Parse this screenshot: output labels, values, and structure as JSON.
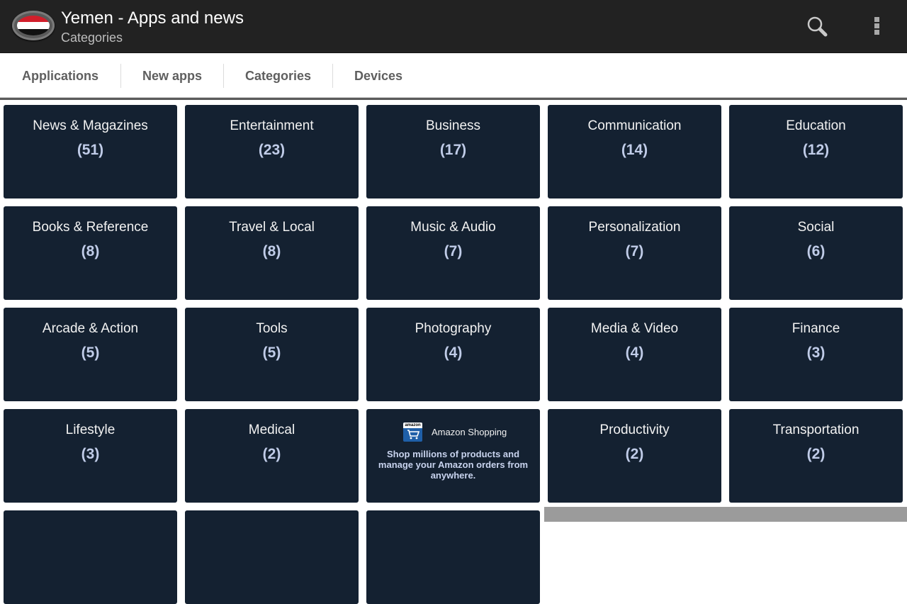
{
  "appbar": {
    "title": "Yemen - Apps and news",
    "subtitle": "Categories",
    "logo_icon": "yemen-flag-icon",
    "actions": [
      {
        "name": "search",
        "icon": "search-icon"
      },
      {
        "name": "overflow-menu",
        "icon": "more-vert-icon"
      }
    ]
  },
  "tabs": [
    {
      "label": "Applications"
    },
    {
      "label": "New apps"
    },
    {
      "label": "Categories"
    },
    {
      "label": "Devices"
    }
  ],
  "categories": [
    {
      "name": "News & Magazines",
      "count": "(51)"
    },
    {
      "name": "Entertainment",
      "count": "(23)"
    },
    {
      "name": "Business",
      "count": "(17)"
    },
    {
      "name": "Communication",
      "count": "(14)"
    },
    {
      "name": "Education",
      "count": "(12)"
    },
    {
      "name": "Books & Reference",
      "count": "(8)"
    },
    {
      "name": "Travel & Local",
      "count": "(8)"
    },
    {
      "name": "Music & Audio",
      "count": "(7)"
    },
    {
      "name": "Personalization",
      "count": "(7)"
    },
    {
      "name": "Social",
      "count": "(6)"
    },
    {
      "name": "Arcade & Action",
      "count": "(5)"
    },
    {
      "name": "Tools",
      "count": "(5)"
    },
    {
      "name": "Photography",
      "count": "(4)"
    },
    {
      "name": "Media & Video",
      "count": "(4)"
    },
    {
      "name": "Finance",
      "count": "(3)"
    },
    {
      "name": "Lifestyle",
      "count": "(3)"
    },
    {
      "name": "Medical",
      "count": "(2)"
    },
    {
      "name": "Productivity",
      "count": "(2)"
    },
    {
      "name": "Transportation",
      "count": "(2)"
    }
  ],
  "ad": {
    "brand": "amazon",
    "title": "Amazon Shopping",
    "description": "Shop millions of products and manage your Amazon orders from anywhere.",
    "icon": "amazon-cart-icon"
  },
  "colors": {
    "appbar": "#222222",
    "tile": "#142131",
    "count": "#c0cce8",
    "tab_text": "#5f5f5f"
  }
}
